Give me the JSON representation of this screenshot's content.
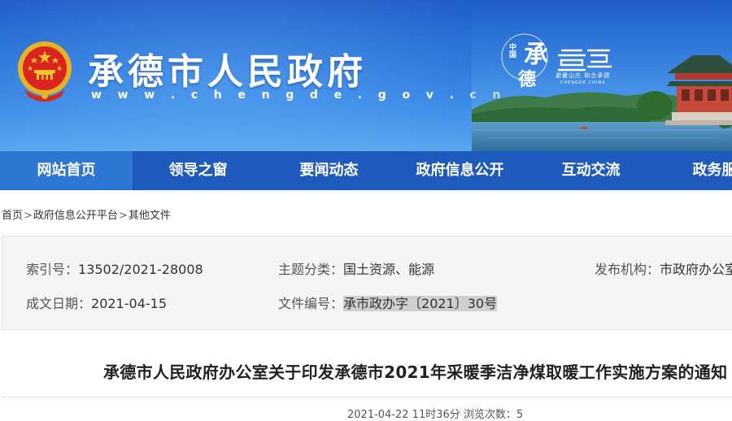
{
  "header": {
    "site_name": "承德市人民政府",
    "site_url": "w w w . c h e n g d e . g o v . c n",
    "city_logo": {
      "zhongguo": "中国",
      "cheng": "承",
      "de": "德",
      "slogan": "避暑山庄 和合承德",
      "english": "CHENGDE CHINA"
    }
  },
  "nav": {
    "items": [
      {
        "label": "网站首页"
      },
      {
        "label": "领导之窗"
      },
      {
        "label": "要闻动态"
      },
      {
        "label": "政府信息公开"
      },
      {
        "label": "互动交流"
      },
      {
        "label": "政务服务"
      }
    ]
  },
  "breadcrumb": {
    "items": [
      "首页",
      "政府信息公开平台",
      "其他文件"
    ],
    "separator": ">"
  },
  "info": {
    "index_label": "索引号：",
    "index_value": "13502/2021-28008",
    "topic_label": "主题分类：",
    "topic_value": "国土资源、能源",
    "publisher_label": "发布机构：",
    "publisher_value": "市政府办公室",
    "date_label": "成文日期：",
    "date_value": "2021-04-15",
    "docno_label": "文件编号：",
    "docno_value": "承市政办字〔2021〕30号"
  },
  "document": {
    "title": "承德市人民政府办公室关于印发承德市2021年采暖季洁净煤取暖工作实施方案的通知",
    "meta": "2021-04-22 11时36分   浏览次数：5"
  },
  "colors": {
    "nav_bg": "#1f5bbd",
    "nav_active": "#2d77d3",
    "banner_top": "#1f5fc9",
    "banner_bottom": "#5aa6ef",
    "info_bg": "#f5f5f5"
  }
}
